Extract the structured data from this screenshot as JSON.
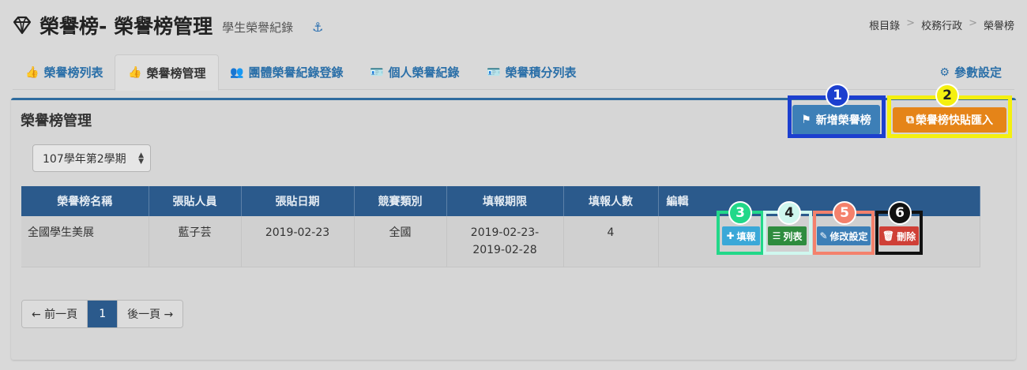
{
  "header": {
    "title": "榮譽榜- 榮譽榜管理",
    "subtitle": "學生榮譽紀錄",
    "anchor_glyph": "⚓"
  },
  "breadcrumb": [
    "根目錄",
    "校務行政",
    "榮譽榜"
  ],
  "breadcrumb_sep": ">",
  "tabs": [
    {
      "label": "榮譽榜列表",
      "icon": "thumbs-up-icon"
    },
    {
      "label": "榮譽榜管理",
      "icon": "thumbs-up-outline-icon"
    },
    {
      "label": "團體榮譽紀錄登錄",
      "icon": "users-icon"
    },
    {
      "label": "個人榮譽紀錄",
      "icon": "id-card-icon"
    },
    {
      "label": "榮譽積分列表",
      "icon": "id-card-icon"
    },
    {
      "label": "參數設定",
      "icon": "gear-icon"
    }
  ],
  "panel": {
    "title": "榮譽榜管理",
    "new_button": "新增榮譽榜",
    "paste_button": "榮譽榜快貼匯入"
  },
  "semester": {
    "selected": "107學年第2學期"
  },
  "table": {
    "headers": [
      "榮譽榜名稱",
      "張貼人員",
      "張貼日期",
      "競賽類別",
      "填報期限",
      "填報人數",
      "編輯"
    ],
    "rows": [
      {
        "name": "全國學生美展",
        "poster": "藍子芸",
        "date": "2019-02-23",
        "category": "全國",
        "deadline_start": "2019-02-23-",
        "deadline_end": "2019-02-28",
        "count": "4"
      }
    ],
    "actions": {
      "fill": "填報",
      "list": "列表",
      "edit": "修改設定",
      "delete": "刪除"
    }
  },
  "pager": {
    "prev": "← 前一頁",
    "current": "1",
    "next": "後一頁 →"
  },
  "annotations": [
    "1",
    "2",
    "3",
    "4",
    "5",
    "6"
  ],
  "colors": {
    "primary": "#2b5a8c",
    "new_button": "#3d7fb7",
    "paste_button": "#e58418",
    "fill_button": "#3aa8d8",
    "list_button": "#2e8c3e",
    "delete_button": "#cf3f36",
    "highlight_1": "#1c3fcf",
    "highlight_2": "#f4f010",
    "highlight_3": "#22d889",
    "highlight_4": "#cff7ee",
    "highlight_5": "#f4816c",
    "highlight_6": "#111111"
  }
}
